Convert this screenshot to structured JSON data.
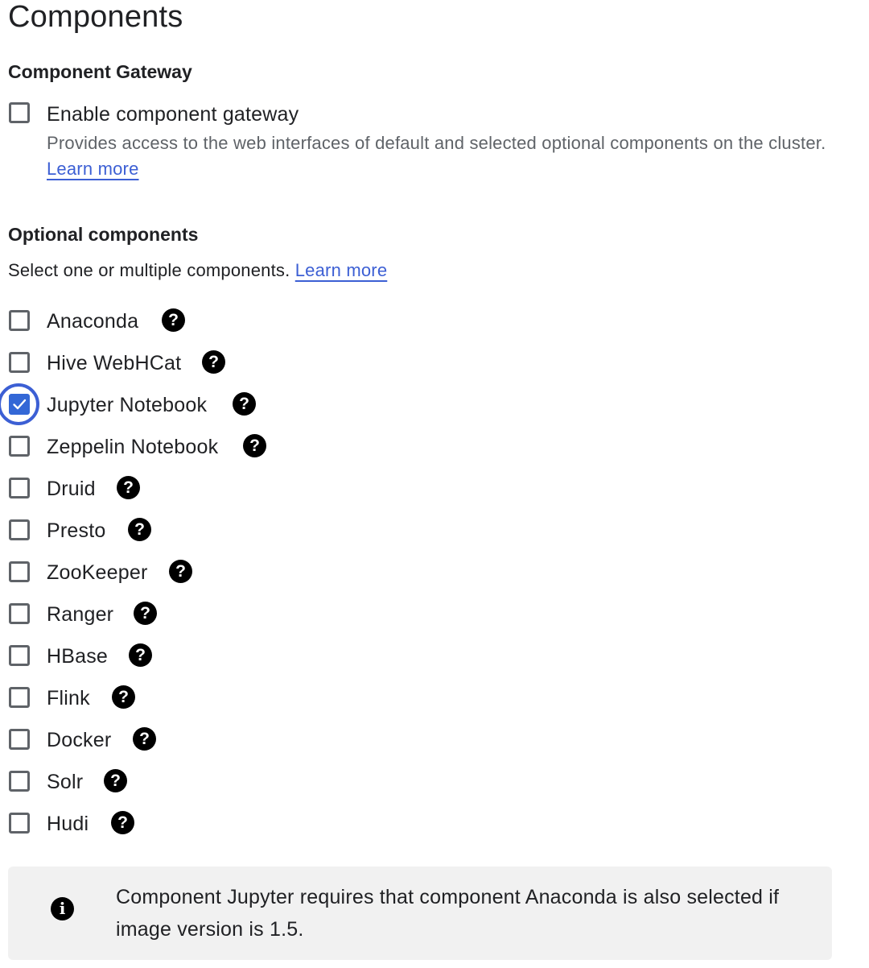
{
  "page": {
    "title": "Components"
  },
  "gateway": {
    "title": "Component Gateway",
    "checkbox_label": "Enable component gateway",
    "checked": false,
    "description": "Provides access to the web interfaces of default and selected optional components on the cluster.",
    "learn_more": "Learn more"
  },
  "optional": {
    "title": "Optional components",
    "description": "Select one or multiple components.",
    "learn_more": "Learn more",
    "components": [
      {
        "label": "Anaconda",
        "checked": false
      },
      {
        "label": "Hive WebHCat",
        "checked": false
      },
      {
        "label": "Jupyter Notebook",
        "checked": true
      },
      {
        "label": "Zeppelin Notebook",
        "checked": false
      },
      {
        "label": "Druid",
        "checked": false
      },
      {
        "label": "Presto",
        "checked": false
      },
      {
        "label": "ZooKeeper",
        "checked": false
      },
      {
        "label": "Ranger",
        "checked": false
      },
      {
        "label": "HBase",
        "checked": false
      },
      {
        "label": "Flink",
        "checked": false
      },
      {
        "label": "Docker",
        "checked": false
      },
      {
        "label": "Solr",
        "checked": false
      },
      {
        "label": "Hudi",
        "checked": false
      }
    ],
    "help_icon_glyph": "?"
  },
  "info": {
    "icon": "info-icon",
    "icon_glyph": "i",
    "text": "Component Jupyter requires that component Anaconda is also selected if image version is 1.5."
  },
  "colors": {
    "accent": "#3367d6",
    "link": "#3c5fd4",
    "info_bg": "#f1f1f1"
  }
}
